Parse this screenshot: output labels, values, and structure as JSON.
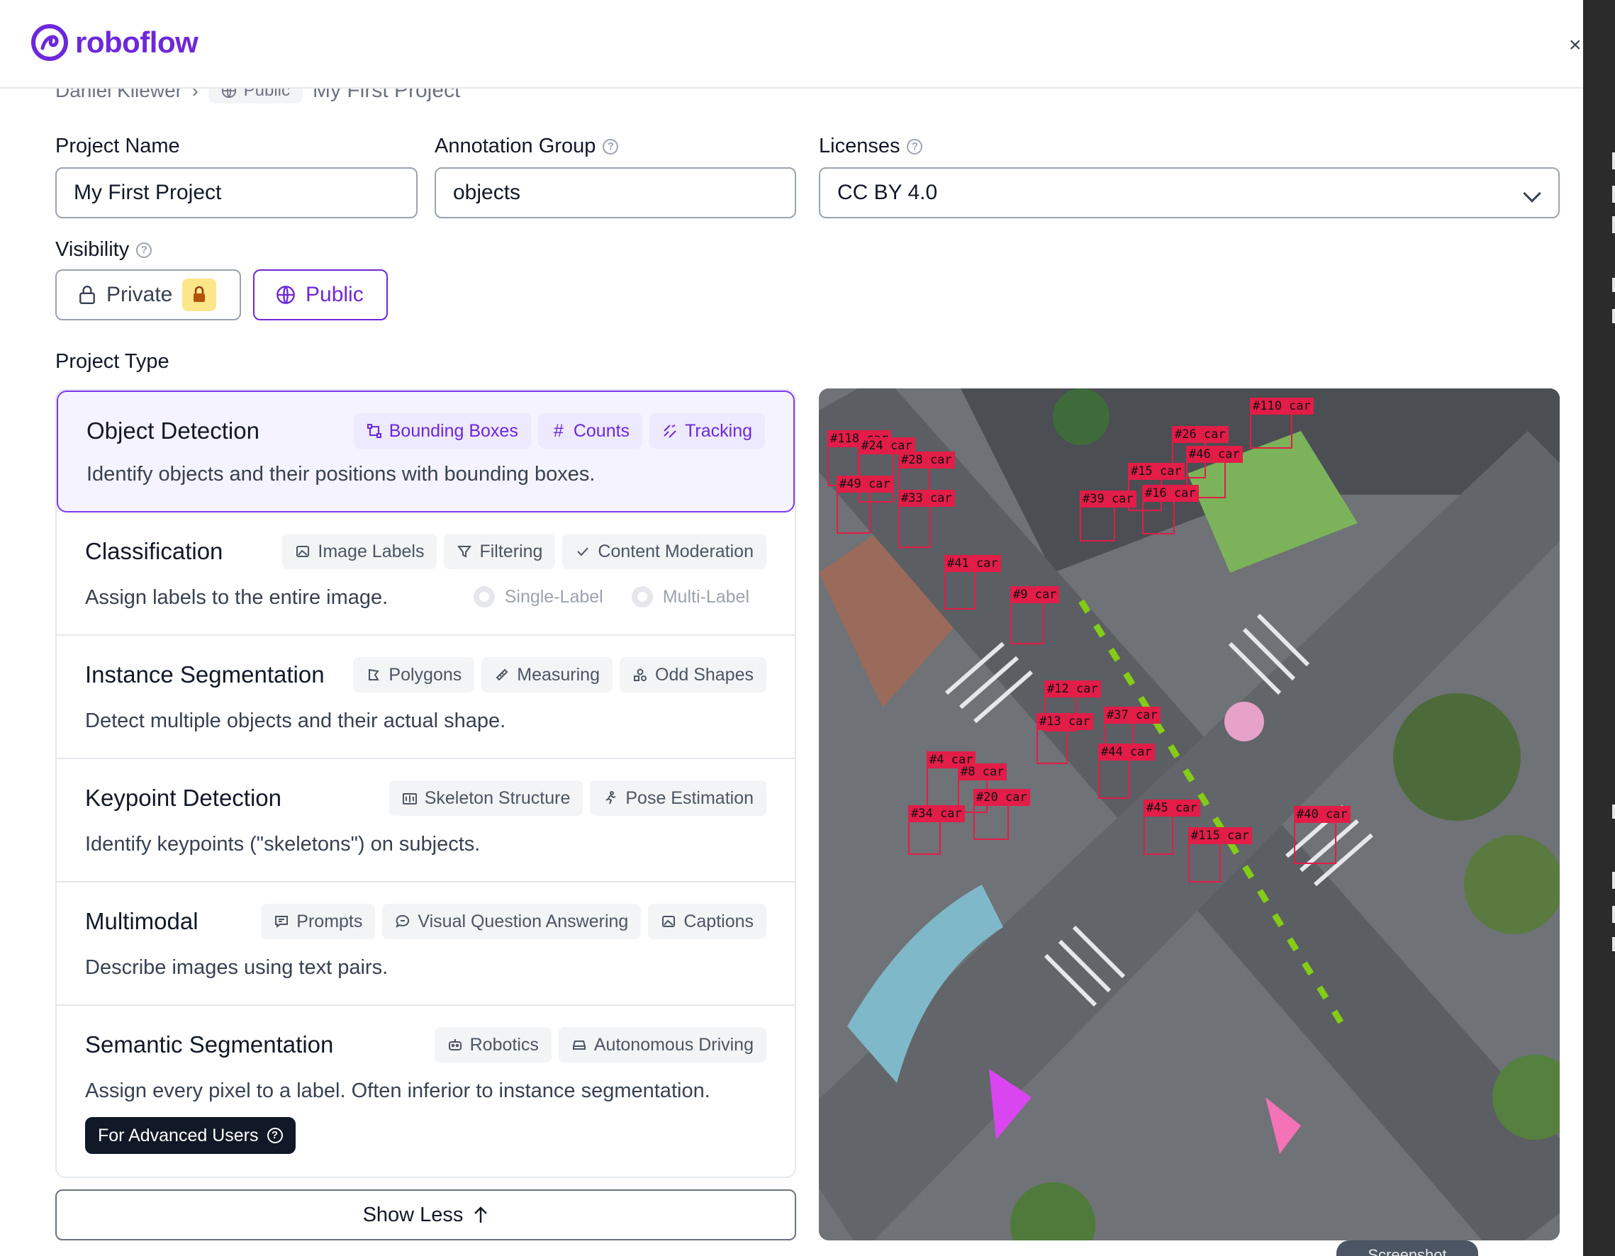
{
  "brand": {
    "name": "roboflow",
    "color": "#6d28d9"
  },
  "breadcrumb": {
    "owner": "Daniel Kliewer",
    "visibility": "Public",
    "project": "My First Project"
  },
  "form": {
    "project_name_label": "Project Name",
    "project_name_value": "My First Project",
    "annotation_group_label": "Annotation Group",
    "annotation_group_value": "objects",
    "licenses_label": "Licenses",
    "licenses_value": "CC BY 4.0",
    "visibility_label": "Visibility",
    "visibility_private": "Private",
    "visibility_public": "Public",
    "visibility_selected": "Public",
    "project_type_label": "Project Type"
  },
  "project_types": [
    {
      "title": "Object Detection",
      "desc": "Identify objects and their positions with bounding boxes.",
      "selected": true,
      "tags": [
        {
          "label": "Bounding Boxes",
          "icon": "bounding-box-icon"
        },
        {
          "label": "Counts",
          "icon": "hash-icon"
        },
        {
          "label": "Tracking",
          "icon": "tracking-icon"
        }
      ]
    },
    {
      "title": "Classification",
      "desc": "Assign labels to the entire image.",
      "tags": [
        {
          "label": "Image Labels",
          "icon": "image-icon"
        },
        {
          "label": "Filtering",
          "icon": "filter-icon"
        },
        {
          "label": "Content Moderation",
          "icon": "check-icon"
        }
      ],
      "options": [
        "Single-Label",
        "Multi-Label"
      ]
    },
    {
      "title": "Instance Segmentation",
      "desc": "Detect multiple objects and their actual shape.",
      "tags": [
        {
          "label": "Polygons",
          "icon": "polygon-icon"
        },
        {
          "label": "Measuring",
          "icon": "ruler-icon"
        },
        {
          "label": "Odd Shapes",
          "icon": "shapes-icon"
        }
      ]
    },
    {
      "title": "Keypoint Detection",
      "desc": "Identify keypoints (\"skeletons\") on subjects.",
      "tags": [
        {
          "label": "Skeleton Structure",
          "icon": "skeleton-icon"
        },
        {
          "label": "Pose Estimation",
          "icon": "running-person-icon"
        }
      ]
    },
    {
      "title": "Multimodal",
      "desc": "Describe images using text pairs.",
      "tags": [
        {
          "label": "Prompts",
          "icon": "message-icon"
        },
        {
          "label": "Visual Question Answering",
          "icon": "chat-bubble-icon"
        },
        {
          "label": "Captions",
          "icon": "image-icon"
        }
      ]
    },
    {
      "title": "Semantic Segmentation",
      "desc": "Assign every pixel to a label. Often inferior to instance segmentation.",
      "tags": [
        {
          "label": "Robotics",
          "icon": "robot-icon"
        },
        {
          "label": "Autonomous Driving",
          "icon": "car-icon"
        }
      ],
      "badge": "For Advanced Users"
    }
  ],
  "show_less": "Show Less",
  "screenshot_tab": "Screenshot",
  "detections": [
    "#118 car",
    "#24 car",
    "#28 car",
    "#49 car",
    "#33 car",
    "#110 car",
    "#26 car",
    "#46 car",
    "#15 car",
    "#16 car",
    "#39 car",
    "#41 car",
    "#9 car",
    "#12 car",
    "#13 car",
    "#37 car",
    "#44 car",
    "#4 car",
    "#8 car",
    "#20 car",
    "#34 car",
    "#45 car",
    "#115 car",
    "#40 car"
  ]
}
